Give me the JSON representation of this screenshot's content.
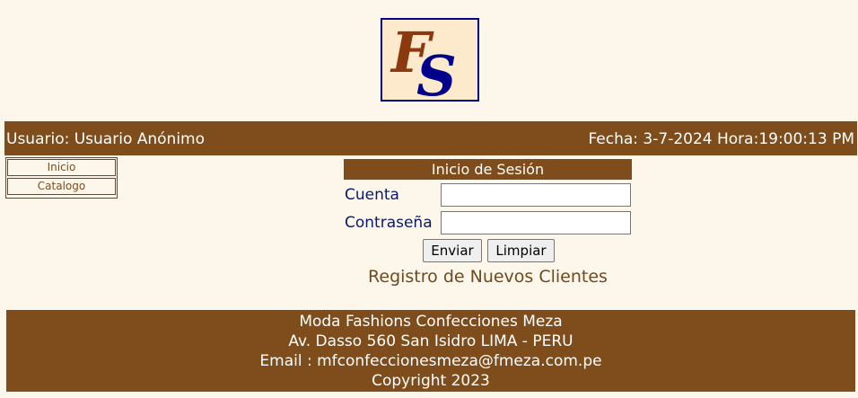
{
  "logo": {
    "text_f": "F",
    "text_s": "S"
  },
  "header": {
    "user_label": "Usuario: Usuario Anónimo",
    "datetime_label": "Fecha: 3-7-2024 Hora:19:00:13 PM"
  },
  "sidebar": {
    "items": [
      {
        "label": "Inicio"
      },
      {
        "label": "Catalogo"
      }
    ]
  },
  "login": {
    "title": "Inicio de Sesión",
    "account_label": "Cuenta",
    "account_value": "",
    "password_label": "Contraseña",
    "password_value": "",
    "submit_label": "Enviar",
    "clear_label": "Limpiar",
    "register_link": "Registro de Nuevos Clientes"
  },
  "footer": {
    "line1": "Moda Fashions Confecciones Meza",
    "line2": "Av. Dasso 560 San Isidro LIMA - PERU",
    "line3": "Email : mfconfeccionesmeza@fmeza.com.pe",
    "line4": "Copyright 2023"
  },
  "colors": {
    "brand_brown": "#7e4d1b",
    "page_background": "#fdf6ea",
    "logo_blue": "#00008b",
    "logo_brown": "#8b3a0f"
  }
}
